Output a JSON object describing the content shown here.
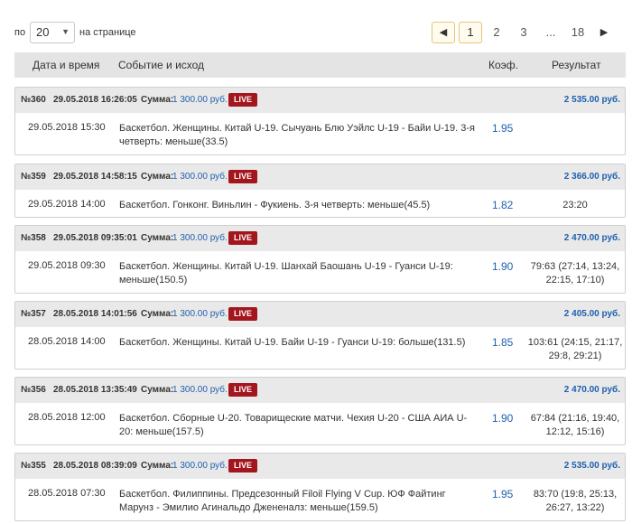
{
  "toolbar": {
    "perpage_prefix": "по",
    "perpage_value": "20",
    "perpage_caret": "▼",
    "perpage_suffix": "на странице"
  },
  "pager": {
    "prev": "◀",
    "pages": [
      "1",
      "2",
      "3",
      "...",
      "18"
    ],
    "next": "▶",
    "current": "1"
  },
  "table_headers": {
    "date": "Дата и время",
    "event": "Событие и исход",
    "coef": "Коэф.",
    "result": "Результат"
  },
  "live_label": "LIVE",
  "sum_label": "Сумма:",
  "bets": [
    {
      "no": "№360",
      "ts": "29.05.2018 16:26:05",
      "sum": "1 300.00 руб.",
      "payout": "2 535.00 руб.",
      "date": "29.05.2018 15:30",
      "desc": "Баскетбол. Женщины. Китай U-19. Сычуань Блю Уэйлс U-19 - Байи U-19. 3-я четверть: меньше(33.5)",
      "coef": "1.95",
      "result": ""
    },
    {
      "no": "№359",
      "ts": "29.05.2018 14:58:15",
      "sum": "1 300.00 руб.",
      "payout": "2 366.00 руб.",
      "date": "29.05.2018 14:00",
      "desc": "Баскетбол. Гонконг. Виньлин - Фукиень. 3-я четверть: меньше(45.5)",
      "coef": "1.82",
      "result": "23:20"
    },
    {
      "no": "№358",
      "ts": "29.05.2018 09:35:01",
      "sum": "1 300.00 руб.",
      "payout": "2 470.00 руб.",
      "date": "29.05.2018 09:30",
      "desc": "Баскетбол. Женщины. Китай U-19. Шанхай Баошань U-19 - Гуанси U-19: меньше(150.5)",
      "coef": "1.90",
      "result": "79:63 (27:14, 13:24, 22:15, 17:10)"
    },
    {
      "no": "№357",
      "ts": "28.05.2018 14:01:56",
      "sum": "1 300.00 руб.",
      "payout": "2 405.00 руб.",
      "date": "28.05.2018 14:00",
      "desc": "Баскетбол. Женщины. Китай U-19. Байи U-19 - Гуанси U-19: больше(131.5)",
      "coef": "1.85",
      "result": "103:61 (24:15, 21:17, 29:8, 29:21)"
    },
    {
      "no": "№356",
      "ts": "28.05.2018 13:35:49",
      "sum": "1 300.00 руб.",
      "payout": "2 470.00 руб.",
      "date": "28.05.2018 12:00",
      "desc": "Баскетбол. Сборные U-20. Товарищеские матчи. Чехия U-20 - США АИА U-20: меньше(157.5)",
      "coef": "1.90",
      "result": "67:84 (21:16, 19:40, 12:12, 15:16)"
    },
    {
      "no": "№355",
      "ts": "28.05.2018 08:39:09",
      "sum": "1 300.00 руб.",
      "payout": "2 535.00 руб.",
      "date": "28.05.2018 07:30",
      "desc": "Баскетбол. Филиппины. Предсезонный Filoil Flying V Cup. ЮФ Файтинг Марунз - Эмилио Агинальдо Джененалз: меньше(159.5)",
      "coef": "1.95",
      "result": "83:70 (19:8, 25:13, 26:27, 13:22)"
    }
  ]
}
